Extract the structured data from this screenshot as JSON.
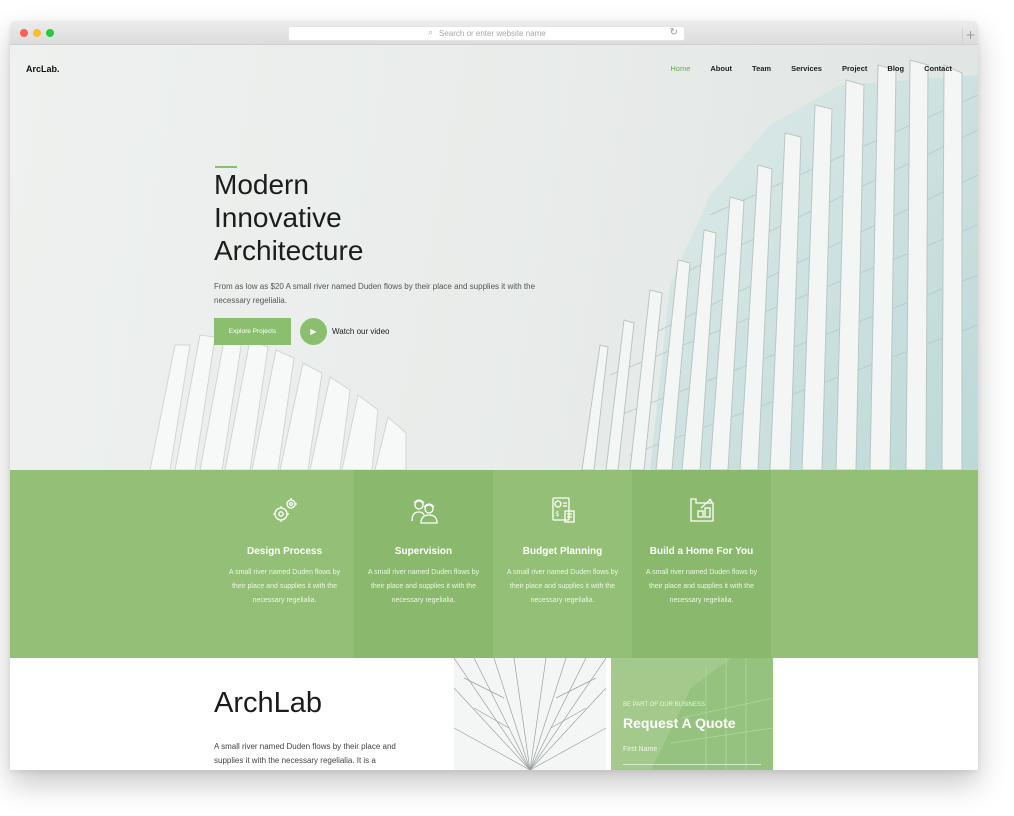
{
  "browser": {
    "url_placeholder": "Search or enter website name",
    "search_glyph": "⌕",
    "reload_glyph": "↻",
    "new_tab_glyph": "+"
  },
  "site": {
    "logo": "ArcLab.",
    "nav": [
      "Home",
      "About",
      "Team",
      "Services",
      "Project",
      "Blog",
      "Contact"
    ],
    "active_nav": "Home"
  },
  "hero": {
    "title_lines": [
      "Modern",
      "Innovative",
      "Architecture"
    ],
    "text": "From as low as $20 A small river named Duden flows by their place and supplies it with the necessary regelialia.",
    "explore_label": "Explore Projects",
    "play_glyph": "▶",
    "watch_label": "Watch our video"
  },
  "services": [
    {
      "title": "Design Process",
      "desc": "A small river named Duden flows by their place and supplies it with the necessary regelialia.",
      "icon": "gears-icon"
    },
    {
      "title": "Supervision",
      "desc": "A small river named Duden flows by their place and supplies it with the necessary regelialia.",
      "icon": "workers-icon"
    },
    {
      "title": "Budget Planning",
      "desc": "A small river named Duden flows by their place and supplies it with the necessary regelialia.",
      "icon": "budget-icon"
    },
    {
      "title": "Build a Home For You",
      "desc": "A small river named Duden flows by their place and supplies it with the necessary regelialia.",
      "icon": "blueprint-icon"
    }
  ],
  "about": {
    "title": "ArchLab",
    "text": "A small river named Duden flows by their place and supplies it with the necessary regelialia. It is a"
  },
  "quote": {
    "kicker": "BE PART OF OUR BUSINESS",
    "title": "Request A Quote",
    "first_name_label": "First Name"
  },
  "colors": {
    "accent": "#8bbf6f",
    "services_bg": "#94bf76",
    "services_bg_alt": "#8ab86c",
    "quote_bg": "#a3c98d"
  }
}
